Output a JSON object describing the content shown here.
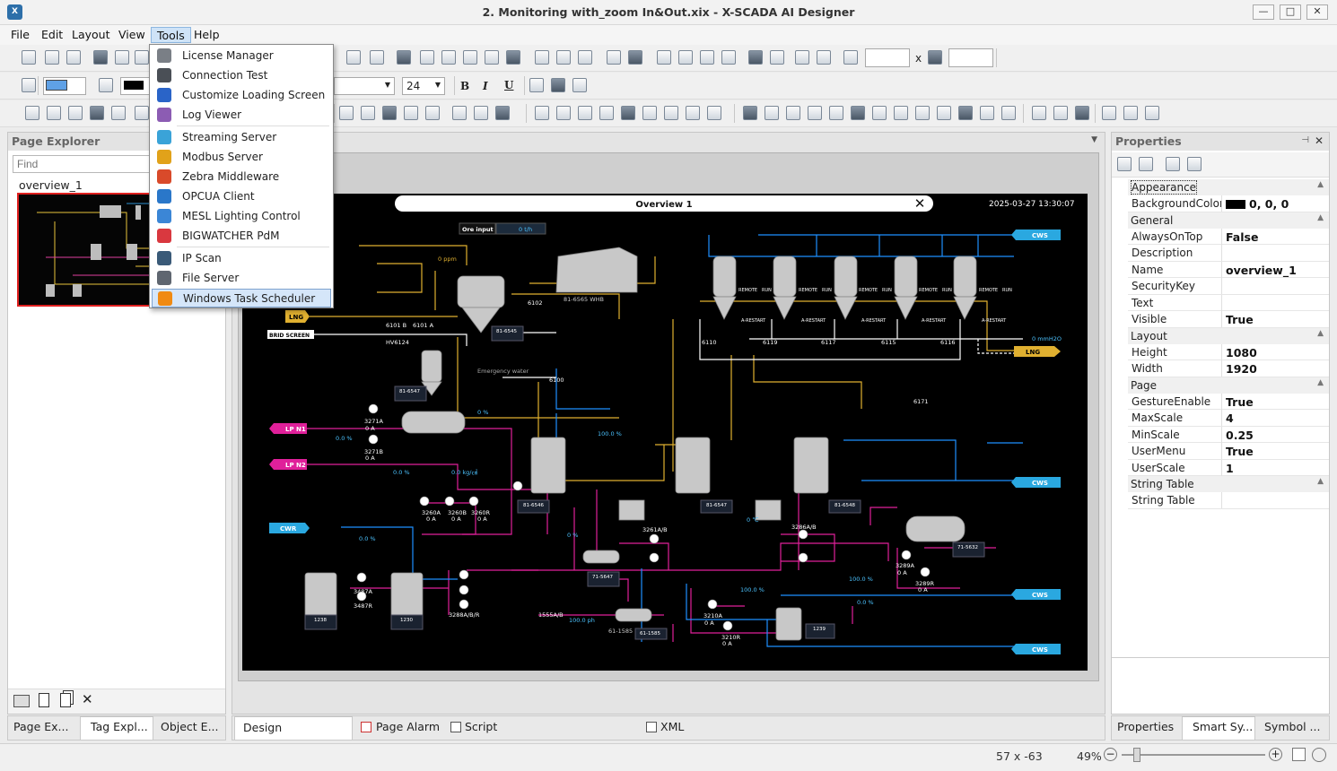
{
  "window": {
    "title": "2. Monitoring with_zoom In&Out.xix - X-SCADA AI Designer",
    "app_icon": "x-scada-icon"
  },
  "menu": [
    "File",
    "Edit",
    "Layout",
    "View",
    "Tools",
    "Help"
  ],
  "tools_menu": [
    {
      "label": "License Manager",
      "icon": "lock-icon",
      "color": "#7a7f86"
    },
    {
      "label": "Connection Test",
      "icon": "network-icon",
      "color": "#4a4f56"
    },
    {
      "label": "Customize Loading Screen",
      "icon": "palette-icon",
      "color": "#2a64c8"
    },
    {
      "label": "Log Viewer",
      "icon": "log-icon",
      "color": "#8c5cb3"
    },
    {
      "label": "Streaming Server",
      "icon": "live-icon",
      "color": "#3aa3d8"
    },
    {
      "label": "Modbus Server",
      "icon": "modbus-icon",
      "color": "#e1a21a"
    },
    {
      "label": "Zebra Middleware",
      "icon": "zebra-icon",
      "color": "#d94a2a"
    },
    {
      "label": "OPCUA Client",
      "icon": "globe-icon",
      "color": "#2a77c9"
    },
    {
      "label": "MESL Lighting Control",
      "icon": "light-icon",
      "color": "#3b86d6"
    },
    {
      "label": "BIGWATCHER PdM",
      "icon": "bigwatcher-icon",
      "color": "#d9383f"
    },
    {
      "label": "IP Scan",
      "icon": "ip-scan-icon",
      "color": "#3a5a78"
    },
    {
      "label": "File Server",
      "icon": "server-icon",
      "color": "#5f6670"
    },
    {
      "label": "Windows Task Scheduler",
      "icon": "clock-icon",
      "color": "#f08a12"
    }
  ],
  "toolbar": {
    "font_size": "24",
    "size_sep": "x",
    "bold": "B",
    "italic": "I",
    "underline": "U"
  },
  "page_explorer": {
    "title": "Page Explorer",
    "find_placeholder": "Find",
    "page": "overview_1"
  },
  "left_tabs": [
    "Page Ex...",
    "Tag Expl...",
    "Object E..."
  ],
  "design_tabs": [
    "Design",
    "Page Alarm",
    "Script",
    "XML"
  ],
  "right_tabs": [
    "Properties",
    "Smart Sy...",
    "Symbol ..."
  ],
  "properties": {
    "title": "Properties",
    "groups": [
      {
        "name": "Appearance",
        "rows": [
          {
            "k": "BackgroundColor",
            "v": "0, 0, 0",
            "swatch": "#000000"
          }
        ]
      },
      {
        "name": "General",
        "rows": [
          {
            "k": "AlwaysOnTop",
            "v": "False"
          },
          {
            "k": "Description",
            "v": ""
          },
          {
            "k": "Name",
            "v": "overview_1"
          },
          {
            "k": "SecurityKey",
            "v": ""
          },
          {
            "k": "Text",
            "v": ""
          },
          {
            "k": "Visible",
            "v": "True"
          }
        ]
      },
      {
        "name": "Layout",
        "rows": [
          {
            "k": "Height",
            "v": "1080"
          },
          {
            "k": "Width",
            "v": "1920"
          }
        ]
      },
      {
        "name": "Page",
        "rows": [
          {
            "k": "GestureEnable",
            "v": "True"
          },
          {
            "k": "MaxScale",
            "v": "4"
          },
          {
            "k": "MinScale",
            "v": "0.25"
          },
          {
            "k": "UserMenu",
            "v": "True"
          },
          {
            "k": "UserScale",
            "v": "1"
          }
        ]
      },
      {
        "name": "String Table",
        "rows": [
          {
            "k": "String Table",
            "v": ""
          }
        ]
      }
    ]
  },
  "status": {
    "coords": "57 x -63",
    "zoom": "49%"
  },
  "scada": {
    "title": "Overview 1",
    "datetime": "2025-03-27 13:30:07",
    "ore_input_label": "Ore input",
    "ore_input_value": "0  t/h",
    "tags": {
      "ppm": "0 ppm",
      "pct": "0 %",
      "lng": "LNG",
      "brid": "BRID SCREEN",
      "hv": "HV6124",
      "lpn1": "LP N1",
      "lpn2": "LP N2",
      "cwr": "CWR",
      "cws": "CWS",
      "mmh2o": "0 mmH2O",
      "kgcm": "0.0 kg/㎠",
      "pct100": "100.0 %",
      "degc": "0 ℃",
      "ph": "100.0 ph",
      "emergency": "Emergency water",
      "whb": "81-6565 WHB",
      "chiler": "61-1585 CHILER",
      "v6101b": "6101 B",
      "v6101a": "6101 A",
      "v6102": "6102",
      "v6100": "6100",
      "v6171": "6171",
      "v1555": "1555A/B",
      "remote": "REMOTE",
      "run": "RUN",
      "arestart": "A-RESTART",
      "v6110": "6110",
      "v6119": "6119",
      "v6117": "6117",
      "v6115": "6115",
      "v6116": "6116",
      "p3271a": "3271A",
      "p3271b": "3271B",
      "p3260a": "3260A",
      "p3260b": "3260B",
      "p3260r": "3260R",
      "p3487a": "3487A",
      "p3487r": "3487R",
      "p3288": "3288A/B/R",
      "p3261": "3261A/B",
      "p3286": "3286A/B",
      "p3289a": "3289A",
      "p3289r": "3289R",
      "p3210a": "3210A",
      "p3210r": "3210R",
      "oa": "0 A",
      "pct00": "0.0 %",
      "tk6546": "81-6546",
      "tk6547": "81-6547",
      "tk6548": "81-6548",
      "tk6545": "81-6545",
      "tk6547b": "81-6547",
      "tk5647": "71-5647",
      "tk5632": "71-5632",
      "tk1238": "1238",
      "tk1230": "1230",
      "tk1239": "1239",
      "tk1585": "61-1585"
    }
  }
}
